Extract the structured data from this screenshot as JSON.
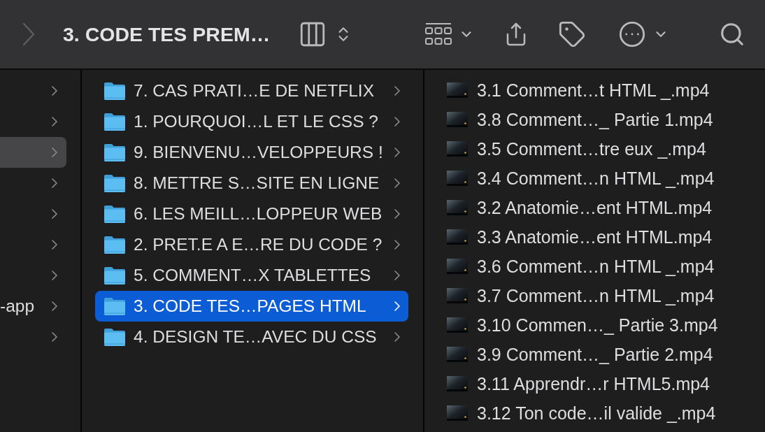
{
  "toolbar": {
    "forward_enabled": false,
    "title": "3. CODE TES PREM…"
  },
  "parent_column": {
    "focused": false,
    "items": [
      {
        "selected": false
      },
      {
        "selected": false
      },
      {
        "selected": true
      },
      {
        "selected": false
      },
      {
        "selected": false
      },
      {
        "selected": false
      },
      {
        "selected": false
      },
      {
        "label": "-app",
        "selected": false
      },
      {
        "selected": false
      }
    ]
  },
  "folder_column": {
    "focused": true,
    "items": [
      {
        "label": "7. CAS PRATI…E DE NETFLIX",
        "selected": false
      },
      {
        "label": "1. POURQUOI…L ET LE CSS ?",
        "selected": false
      },
      {
        "label": "9. BIENVENU…VELOPPEURS !",
        "selected": false
      },
      {
        "label": "8. METTRE S…SITE EN LIGNE",
        "selected": false
      },
      {
        "label": "6. LES MEILL…LOPPEUR WEB",
        "selected": false
      },
      {
        "label": "2. PRET.E A E…RE DU CODE ?",
        "selected": false
      },
      {
        "label": "5. COMMENT…X TABLETTES",
        "selected": false
      },
      {
        "label": "3. CODE TES…PAGES HTML",
        "selected": true
      },
      {
        "label": "4. DESIGN TE…AVEC DU CSS",
        "selected": false
      }
    ]
  },
  "file_column": {
    "items": [
      {
        "label": "3.1 Comment…t HTML _.mp4",
        "selected": false
      },
      {
        "label": "3.8 Comment…_ Partie 1.mp4",
        "selected": false
      },
      {
        "label": "3.5 Comment…tre eux _.mp4",
        "selected": false
      },
      {
        "label": "3.4 Comment…n HTML _.mp4",
        "selected": false
      },
      {
        "label": "3.2 Anatomie…ent HTML.mp4",
        "selected": false
      },
      {
        "label": "3.3 Anatomie…ent HTML.mp4",
        "selected": false
      },
      {
        "label": "3.6 Comment…n HTML _.mp4",
        "selected": false
      },
      {
        "label": "3.7 Comment…n HTML _.mp4",
        "selected": false
      },
      {
        "label": "3.10 Commen…_ Partie 3.mp4",
        "selected": false
      },
      {
        "label": "3.9 Comment…_ Partie 2.mp4",
        "selected": false
      },
      {
        "label": "3.11 Apprendr…r HTML5.mp4",
        "selected": false
      },
      {
        "label": "3.12 Ton code…il valide _.mp4",
        "selected": false
      }
    ]
  }
}
